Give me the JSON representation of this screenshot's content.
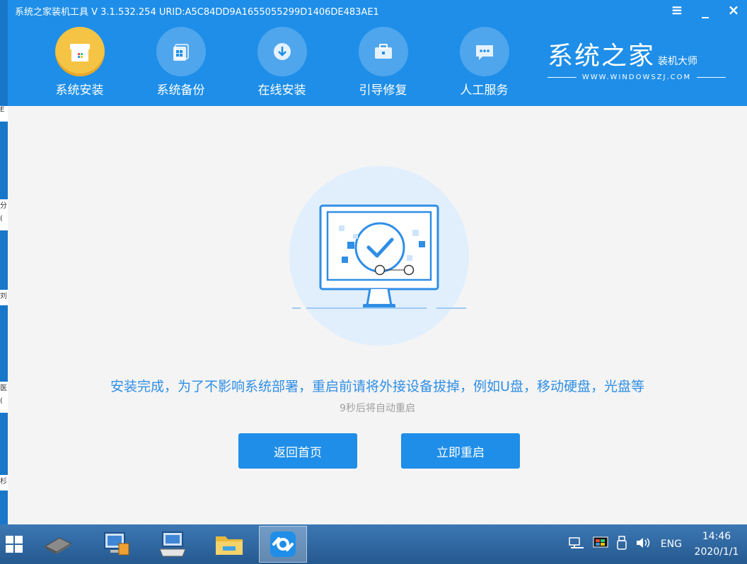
{
  "window": {
    "title": "系统之家装机工具 V 3.1.532.254 URID:A5C84DD9A1655055299D1406DE483AE1",
    "controls": {
      "menu": "≡",
      "minimize": "_",
      "close": "×"
    }
  },
  "nav": {
    "items": [
      {
        "label": "系统安装",
        "icon": "windows-box-icon",
        "active": true
      },
      {
        "label": "系统备份",
        "icon": "backup-icon",
        "active": false
      },
      {
        "label": "在线安装",
        "icon": "download-icon",
        "active": false
      },
      {
        "label": "引导修复",
        "icon": "toolbox-icon",
        "active": false
      },
      {
        "label": "人工服务",
        "icon": "chat-icon",
        "active": false
      }
    ]
  },
  "brand": {
    "title": "系统之家",
    "subtitle": "装机大师",
    "url": "WWW.WINDOWSZJ.COM"
  },
  "main": {
    "message": "安装完成，为了不影响系统部署，重启前请将外接设备拔掉，例如U盘，移动硬盘，光盘等",
    "countdown": "9秒后将自动重启",
    "back_button": "返回首页",
    "restart_button": "立即重启"
  },
  "colors": {
    "accent": "#1e8ee8",
    "active_nav": "#f5c445",
    "message": "#2f8ee5"
  },
  "taskbar": {
    "apps": [
      "start-icon",
      "hard-drive-icon",
      "computer-icon",
      "keyboard-icon",
      "folder-icon",
      "installer-app-icon"
    ],
    "tray_lang": "ENG",
    "time": "14:46",
    "date": "2020/1/1"
  },
  "desktop_fragments": [
    "E",
    "分",
    "(",
    "刘",
    "医",
    "(",
    "杉"
  ]
}
